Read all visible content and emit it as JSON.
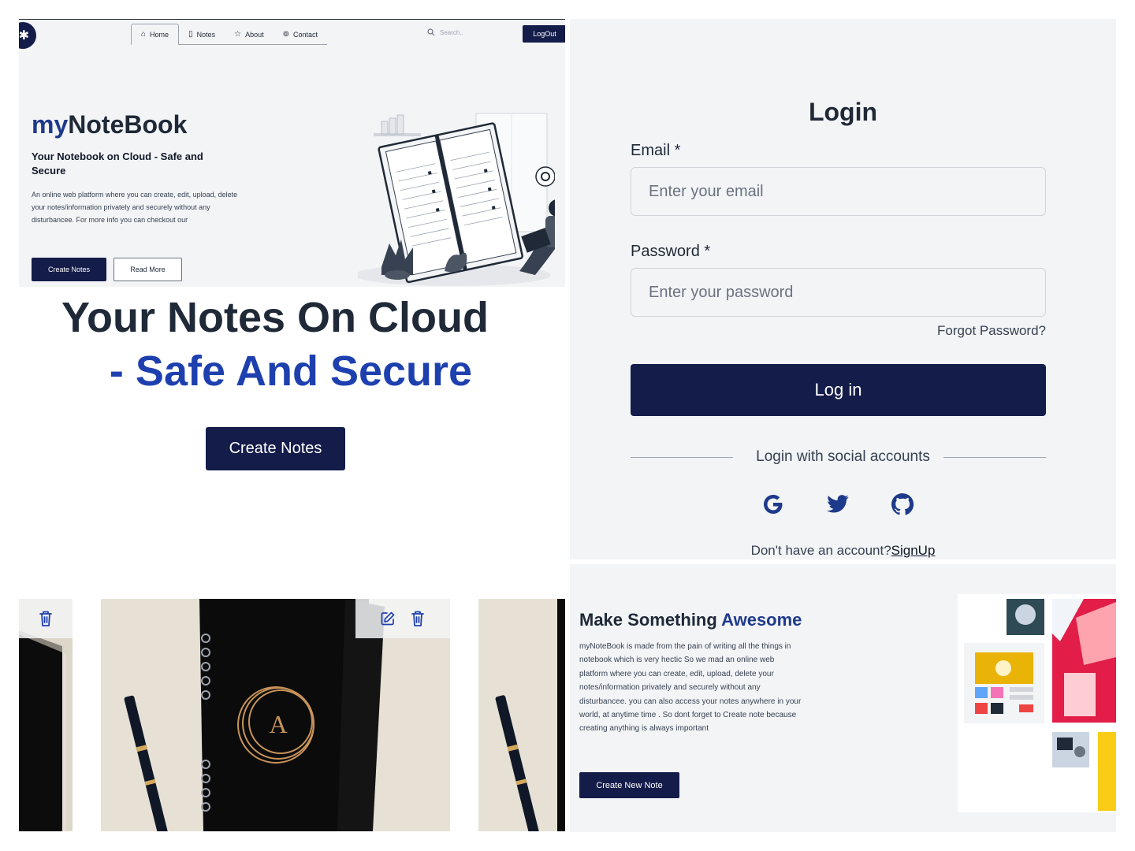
{
  "hero": {
    "logo_glyph": "✱",
    "nav": [
      {
        "icon": "home-icon",
        "glyph": "⌂",
        "label": "Home"
      },
      {
        "icon": "book-icon",
        "glyph": "▯",
        "label": "Notes"
      },
      {
        "icon": "star-icon",
        "glyph": "☆",
        "label": "About"
      },
      {
        "icon": "at-icon",
        "glyph": "⊚",
        "label": "Contact"
      }
    ],
    "search_placeholder": "Search..",
    "logout_label": "LogOut",
    "title_part1": "my",
    "title_part2": "NoteBook",
    "subtitle": "Your Notebook on Cloud - Safe and Secure",
    "description": "An online web platform where you can create, edit, upload, delete your notes/information privately and securely without any disturbancee. For more info you can checkout our",
    "primary_button": "Create Notes",
    "secondary_button": "Read More"
  },
  "tagline": {
    "line1": "Your Notes On Cloud",
    "line2_dash": "- ",
    "line2": "Safe And Secure",
    "button": "Create Notes"
  },
  "login": {
    "title": "Login",
    "email_label": "Email *",
    "email_placeholder": "Enter your email",
    "password_label": "Password *",
    "password_placeholder": "Enter your password",
    "forgot": "Forgot Password?",
    "submit": "Log in",
    "social_text": "Login with social accounts",
    "social": [
      "google-icon",
      "twitter-icon",
      "github-icon"
    ],
    "no_account": "Don't have an account?",
    "signup": "SignUp"
  },
  "notes": {
    "cards": [
      {
        "letter": "A"
      }
    ]
  },
  "awesome": {
    "title_part1": "Make Something ",
    "title_part2": "Awesome",
    "description": "myNoteBook is made from the pain of writing all the things in notebook which is very hectic So we mad an online web platform where you can create, edit, upload, delete your notes/information privately and securely without any disturbancee. you can also access your notes anywhere in your world, at anytime time . So dont forget to Create note because creating anything is always important",
    "button": "Create New Note"
  },
  "colors": {
    "navy": "#141c4a",
    "accent_blue": "#1e40af",
    "panel_bg": "#f3f4f6"
  }
}
